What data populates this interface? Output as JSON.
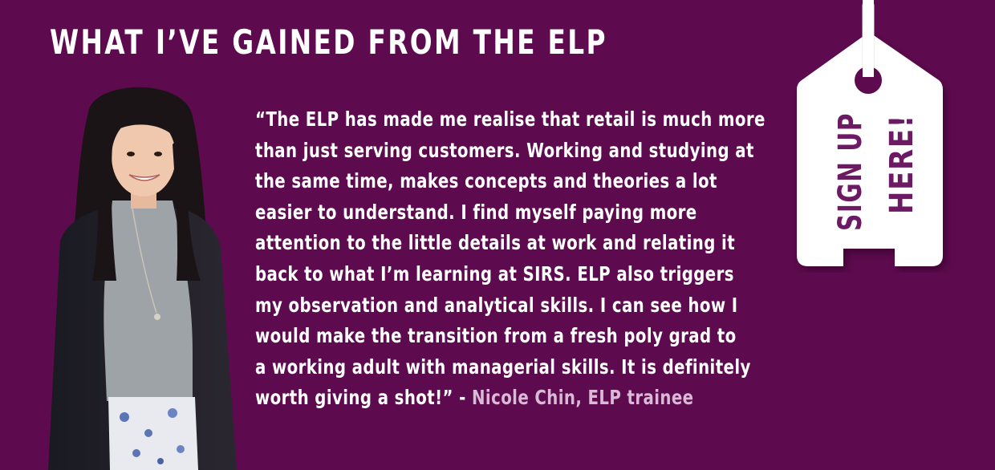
{
  "heading": "WHAT I’VE GAINED FROM THE ELP",
  "quote": {
    "lines": [
      "“The ELP has made me realise that retail is much more",
      "than just serving customers. Working and studying at",
      "the same time, makes concepts and theories a lot",
      "easier to understand. I find myself paying more",
      "attention to the little details at work and relating it",
      "back to what I’m learning at SIRS. ELP also triggers",
      "my observation and analytical skills. I can see how I",
      "would make the transition from a fresh poly grad to",
      "a working adult with managerial skills. It is definitely"
    ],
    "last_line": "worth giving a shot!” - ",
    "attribution": "Nicole Chin, ELP trainee"
  },
  "tag": {
    "line1": "SIGN UP",
    "line2": "HERE!"
  },
  "colors": {
    "background": "#5e0a4f",
    "text": "#ffffff",
    "attribution": "#d9b9d6",
    "tag_text": "#6b1a63"
  }
}
